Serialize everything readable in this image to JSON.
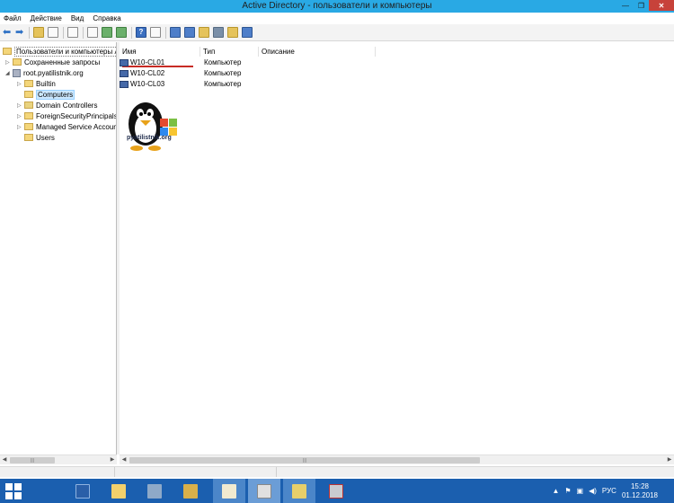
{
  "window": {
    "title": "Active Directory - пользователи и компьютеры",
    "min_glyph": "—",
    "max_glyph": "❐",
    "close_glyph": "✕"
  },
  "menu": [
    "Файл",
    "Действие",
    "Вид",
    "Справка"
  ],
  "tree": {
    "root_label": "Пользователи и компьютеры A",
    "saved_queries": "Сохраненные запросы",
    "domain": "root.pyatilistnik.org",
    "children": [
      "Builtin",
      "Computers",
      "Domain Controllers",
      "ForeignSecurityPrincipals",
      "Managed Service Accoun",
      "Users"
    ],
    "selected": "Computers"
  },
  "list": {
    "columns": [
      "Имя",
      "Тип",
      "Описание"
    ],
    "rows": [
      {
        "name": "W10-CL01",
        "type": "Компьютер"
      },
      {
        "name": "W10-CL02",
        "type": "Компьютер"
      },
      {
        "name": "W10-CL03",
        "type": "Компьютер"
      }
    ]
  },
  "logo_text": "pyatilistnik.org",
  "taskbar": {
    "language": "РУС",
    "time": "15:28",
    "date": "01.12.2018"
  },
  "colors": {
    "titlebar": "#29a9e4",
    "taskbar": "#1b5faf",
    "close_button": "#c7423a",
    "highlight_underline": "#c72b24"
  }
}
